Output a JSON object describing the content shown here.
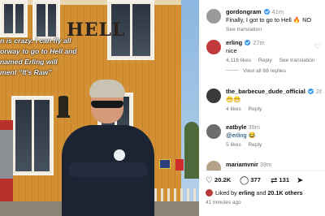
{
  "photo": {
    "sign_text": "HELL",
    "caption_lines": [
      "n is crazy. I can fly all",
      "orway to go to Hell and",
      "named Erling will",
      "ment “It's Raw”"
    ]
  },
  "comments": [
    {
      "username": "gordongram",
      "verified": true,
      "ago": "41m",
      "text": "Finally, I got to go to Hell 🔥 NO",
      "meta": [
        "See translation"
      ],
      "avatar_color": "#9a9a9a"
    },
    {
      "username": "erling",
      "verified": true,
      "ago": "27m",
      "text": "nice",
      "meta": [
        "4,116 likes",
        "Reply",
        "See translation"
      ],
      "view_replies": "View all 68 replies",
      "avatar_color": "#c0393b"
    },
    {
      "username": "the_barbecue_dude_official",
      "verified": true,
      "ago": "26m",
      "text": "😁😁",
      "meta": [
        "4 likes",
        "Reply"
      ],
      "avatar_color": "#3a3a3a"
    },
    {
      "username": "eatbyle",
      "verified": false,
      "ago": "39m",
      "text": "@erling 😂",
      "meta": [
        "5 likes",
        "Reply"
      ],
      "avatar_color": "#6d6d6d"
    },
    {
      "username": "mariamvnir",
      "verified": false,
      "ago": "39m",
      "text": "",
      "meta": [],
      "avatar_color": "#b5a28a"
    }
  ],
  "actions": {
    "likes_count": "20.2K",
    "comments_count": "377",
    "reposts_count": "131",
    "heart_icon": "heart-icon",
    "comment_icon": "comment-icon",
    "repost_icon": "repost-icon",
    "share_icon": "share-icon"
  },
  "liked_by": {
    "prefix": "Liked by",
    "user": "erling",
    "and": "and",
    "others": "20.1K others"
  },
  "posted_ago": "41 minutes ago"
}
